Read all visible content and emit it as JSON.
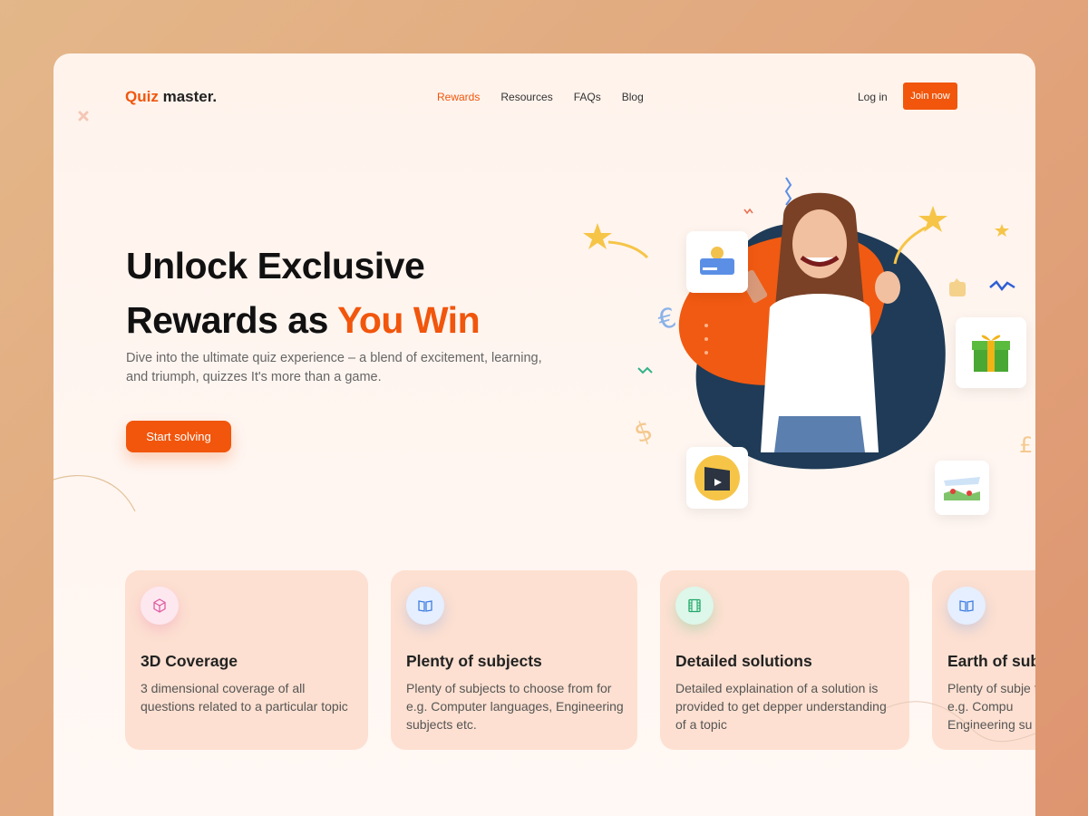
{
  "brand": {
    "name_accent": "Quiz",
    "name_rest": "master."
  },
  "nav": {
    "items": [
      "Rewards",
      "Resources",
      "FAQs",
      "Blog"
    ],
    "active": 0
  },
  "auth": {
    "login": "Log in",
    "join": "Join now"
  },
  "hero": {
    "title_line1": "Unlock Exclusive",
    "title_line2_prefix": "Rewards as ",
    "title_line2_accent": "You Win",
    "subtitle": "Dive into the ultimate quiz experience – a blend of excitement, learning, and triumph,   quizzes It's more than a game.",
    "cta": "Start solving"
  },
  "features": [
    {
      "title": "3D Coverage",
      "desc": "3 dimensional coverage of all questions related to a particular topic",
      "icon": "cube-icon"
    },
    {
      "title": "Plenty of subjects",
      "desc": "Plenty of subjects to choose from for e.g. Computer languages, Engineering subjects etc.",
      "icon": "book-icon"
    },
    {
      "title": "Detailed solutions",
      "desc": "Detailed explaination of a solution is provided to get depper understanding of a topic",
      "icon": "film-icon"
    },
    {
      "title": "Earth  of sub",
      "desc": "Plenty of subje for e.g. Compu Engineering su",
      "icon": "book-icon"
    }
  ],
  "colors": {
    "accent": "#f1560c",
    "navy": "#1f3b57",
    "card": "#fde0d1"
  }
}
